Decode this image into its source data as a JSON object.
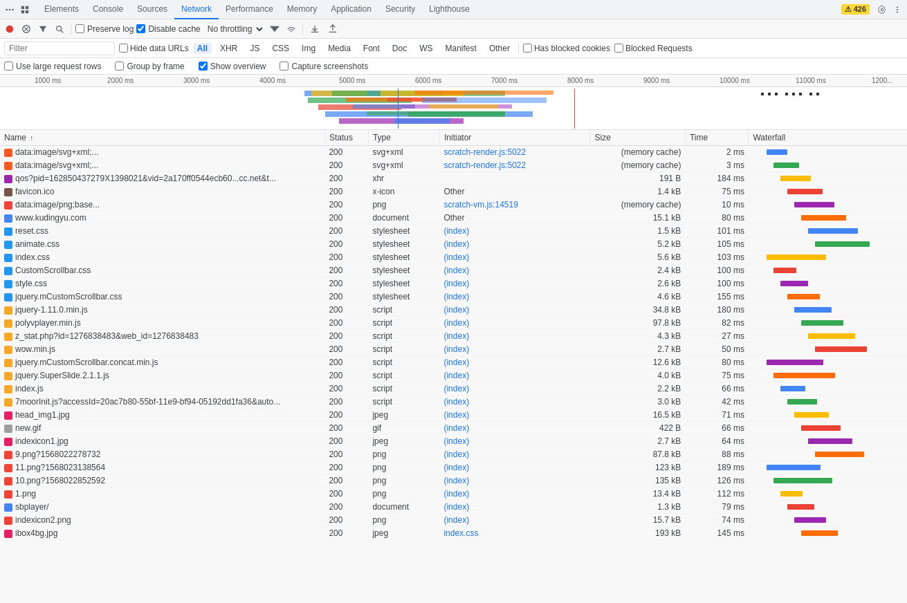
{
  "tabs": [
    {
      "label": "Elements",
      "active": false
    },
    {
      "label": "Console",
      "active": false
    },
    {
      "label": "Sources",
      "active": false
    },
    {
      "label": "Network",
      "active": true
    },
    {
      "label": "Performance",
      "active": false
    },
    {
      "label": "Memory",
      "active": false
    },
    {
      "label": "Application",
      "active": false
    },
    {
      "label": "Security",
      "active": false
    },
    {
      "label": "Lighthouse",
      "active": false
    }
  ],
  "toolbar": {
    "record_label": "Record",
    "clear_label": "Clear",
    "filter_label": "Filter",
    "search_label": "Search",
    "preserve_log_label": "Preserve log",
    "disable_cache_label": "Disable cache",
    "throttle_label": "No throttling",
    "import_label": "Import",
    "export_label": "Export",
    "warning_count": "426"
  },
  "filter_bar": {
    "placeholder": "Filter",
    "hide_data_urls_label": "Hide data URLs",
    "types": [
      "All",
      "XHR",
      "JS",
      "CSS",
      "Img",
      "Media",
      "Font",
      "Doc",
      "WS",
      "Manifest",
      "Other"
    ],
    "active_type": "All",
    "has_blocked_cookies_label": "Has blocked cookies",
    "blocked_requests_label": "Blocked Requests"
  },
  "options_bar": {
    "large_rows_label": "Use large request rows",
    "large_rows_checked": false,
    "group_by_frame_label": "Group by frame",
    "show_overview_label": "Show overview",
    "show_overview_checked": true,
    "capture_screenshots_label": "Capture screenshots"
  },
  "ruler": {
    "ticks": [
      "1000 ms",
      "2000 ms",
      "3000 ms",
      "4000 ms",
      "5000 ms",
      "6000 ms",
      "7000 ms",
      "8000 ms",
      "9000 ms",
      "10000 ms",
      "11000 ms",
      "1200..."
    ]
  },
  "table": {
    "columns": [
      "Name",
      "Status",
      "Type",
      "Initiator",
      "Size",
      "Time",
      "Waterfall"
    ],
    "rows": [
      {
        "name": "data:image/svg+xml;...",
        "status": "200",
        "type": "svg+xml",
        "initiator": "scratch-render.js:5022",
        "initiator_link": true,
        "size": "(memory cache)",
        "time": "2 ms",
        "icon_type": "svg"
      },
      {
        "name": "data:image/svg+xml;...",
        "status": "200",
        "type": "svg+xml",
        "initiator": "scratch-render.js:5022",
        "initiator_link": true,
        "size": "(memory cache)",
        "time": "3 ms",
        "icon_type": "svg"
      },
      {
        "name": "qos?pid=162850437279X1398021&vid=2a170ff0544ecb60...cc.net&t...",
        "status": "200",
        "type": "xhr",
        "initiator": "",
        "initiator_link": false,
        "size": "191 B",
        "time": "184 ms",
        "icon_type": "xhr"
      },
      {
        "name": "favicon.ico",
        "status": "200",
        "type": "x-icon",
        "initiator": "Other",
        "initiator_link": false,
        "size": "1.4 kB",
        "time": "75 ms",
        "icon_type": "ico"
      },
      {
        "name": "data:image/png;base...",
        "status": "200",
        "type": "png",
        "initiator": "scratch-vm.js:14519",
        "initiator_link": true,
        "size": "(memory cache)",
        "time": "10 ms",
        "icon_type": "png"
      },
      {
        "name": "www.kudingyu.com",
        "status": "200",
        "type": "document",
        "initiator": "Other",
        "initiator_link": false,
        "size": "15.1 kB",
        "time": "80 ms",
        "icon_type": "doc"
      },
      {
        "name": "reset.css",
        "status": "200",
        "type": "stylesheet",
        "initiator": "(index)",
        "initiator_link": true,
        "size": "1.5 kB",
        "time": "101 ms",
        "icon_type": "css"
      },
      {
        "name": "animate.css",
        "status": "200",
        "type": "stylesheet",
        "initiator": "(index)",
        "initiator_link": true,
        "size": "5.2 kB",
        "time": "105 ms",
        "icon_type": "css"
      },
      {
        "name": "index.css",
        "status": "200",
        "type": "stylesheet",
        "initiator": "(index)",
        "initiator_link": true,
        "size": "5.6 kB",
        "time": "103 ms",
        "icon_type": "css"
      },
      {
        "name": "CustomScrollbar.css",
        "status": "200",
        "type": "stylesheet",
        "initiator": "(index)",
        "initiator_link": true,
        "size": "2.4 kB",
        "time": "100 ms",
        "icon_type": "css"
      },
      {
        "name": "style.css",
        "status": "200",
        "type": "stylesheet",
        "initiator": "(index)",
        "initiator_link": true,
        "size": "2.6 kB",
        "time": "100 ms",
        "icon_type": "css"
      },
      {
        "name": "jquery.mCustomScrollbar.css",
        "status": "200",
        "type": "stylesheet",
        "initiator": "(index)",
        "initiator_link": true,
        "size": "4.6 kB",
        "time": "155 ms",
        "icon_type": "css"
      },
      {
        "name": "jquery-1.11.0.min.js",
        "status": "200",
        "type": "script",
        "initiator": "(index)",
        "initiator_link": true,
        "size": "34.8 kB",
        "time": "180 ms",
        "icon_type": "js"
      },
      {
        "name": "polyvplayer.min.js",
        "status": "200",
        "type": "script",
        "initiator": "(index)",
        "initiator_link": true,
        "size": "97.8 kB",
        "time": "82 ms",
        "icon_type": "js"
      },
      {
        "name": "z_stat.php?id=1276838483&web_id=1276838483",
        "status": "200",
        "type": "script",
        "initiator": "(index)",
        "initiator_link": true,
        "size": "4.3 kB",
        "time": "27 ms",
        "icon_type": "js"
      },
      {
        "name": "wow.min.js",
        "status": "200",
        "type": "script",
        "initiator": "(index)",
        "initiator_link": true,
        "size": "2.7 kB",
        "time": "50 ms",
        "icon_type": "js"
      },
      {
        "name": "jquery.mCustomScrollbar.concat.min.js",
        "status": "200",
        "type": "script",
        "initiator": "(index)",
        "initiator_link": true,
        "size": "12.6 kB",
        "time": "80 ms",
        "icon_type": "js"
      },
      {
        "name": "jquery.SuperSlide.2.1.1.js",
        "status": "200",
        "type": "script",
        "initiator": "(index)",
        "initiator_link": true,
        "size": "4.0 kB",
        "time": "75 ms",
        "icon_type": "js"
      },
      {
        "name": "index.js",
        "status": "200",
        "type": "script",
        "initiator": "(index)",
        "initiator_link": true,
        "size": "2.2 kB",
        "time": "66 ms",
        "icon_type": "js"
      },
      {
        "name": "7moorInit.js?accessId=20ac7b80-55bf-11e9-bf94-05192dd1fa36&auto...",
        "status": "200",
        "type": "script",
        "initiator": "(index)",
        "initiator_link": true,
        "size": "3.0 kB",
        "time": "42 ms",
        "icon_type": "js"
      },
      {
        "name": "head_img1.jpg",
        "status": "200",
        "type": "jpeg",
        "initiator": "(index)",
        "initiator_link": true,
        "size": "16.5 kB",
        "time": "71 ms",
        "icon_type": "jpeg"
      },
      {
        "name": "new.gif",
        "status": "200",
        "type": "gif",
        "initiator": "(index)",
        "initiator_link": true,
        "size": "422 B",
        "time": "66 ms",
        "icon_type": "gif"
      },
      {
        "name": "indexicon1.jpg",
        "status": "200",
        "type": "jpeg",
        "initiator": "(index)",
        "initiator_link": true,
        "size": "2.7 kB",
        "time": "64 ms",
        "icon_type": "jpeg"
      },
      {
        "name": "9.png?1568022278732",
        "status": "200",
        "type": "png",
        "initiator": "(index)",
        "initiator_link": true,
        "size": "87.8 kB",
        "time": "88 ms",
        "icon_type": "png"
      },
      {
        "name": "11.png?1568023138564",
        "status": "200",
        "type": "png",
        "initiator": "(index)",
        "initiator_link": true,
        "size": "123 kB",
        "time": "189 ms",
        "icon_type": "png"
      },
      {
        "name": "10.png?1568022852592",
        "status": "200",
        "type": "png",
        "initiator": "(index)",
        "initiator_link": true,
        "size": "135 kB",
        "time": "126 ms",
        "icon_type": "png"
      },
      {
        "name": "1.png",
        "status": "200",
        "type": "png",
        "initiator": "(index)",
        "initiator_link": true,
        "size": "13.4 kB",
        "time": "112 ms",
        "icon_type": "png"
      },
      {
        "name": "sbplayer/",
        "status": "200",
        "type": "document",
        "initiator": "(index)",
        "initiator_link": true,
        "size": "1.3 kB",
        "time": "79 ms",
        "icon_type": "doc"
      },
      {
        "name": "indexicon2.png",
        "status": "200",
        "type": "png",
        "initiator": "(index)",
        "initiator_link": true,
        "size": "15.7 kB",
        "time": "74 ms",
        "icon_type": "png"
      },
      {
        "name": "ibox4bg.jpg",
        "status": "200",
        "type": "jpeg",
        "initiator": "index.css",
        "initiator_link": true,
        "size": "193 kB",
        "time": "145 ms",
        "icon_type": "jpeg"
      }
    ]
  },
  "colors": {
    "accent": "#1a73e8",
    "border": "#dadce0",
    "hover": "#f0f8ff",
    "warning": "#fdd835",
    "waterfall_blue": "#4285f4",
    "waterfall_green": "#34a853",
    "waterfall_orange": "#ff6d00",
    "red_line": "#e53935"
  }
}
